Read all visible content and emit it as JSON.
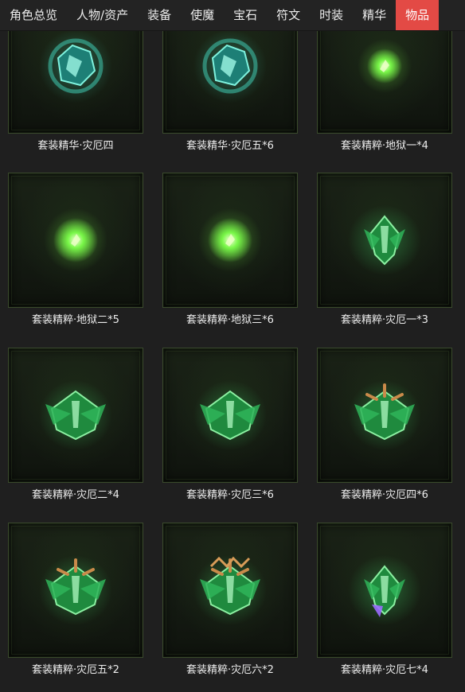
{
  "tabs": [
    {
      "label": "角色总览",
      "active": false
    },
    {
      "label": "人物/资产",
      "active": false
    },
    {
      "label": "装备",
      "active": false
    },
    {
      "label": "使魔",
      "active": false
    },
    {
      "label": "宝石",
      "active": false
    },
    {
      "label": "符文",
      "active": false
    },
    {
      "label": "时装",
      "active": false
    },
    {
      "label": "精华",
      "active": false
    },
    {
      "label": "物品",
      "active": true
    }
  ],
  "colors": {
    "active_tab": "#e34a45",
    "background": "#1f1f1f",
    "frame_border": "#3a4a2c"
  },
  "items": [
    {
      "name": "套装精华·灾厄四",
      "icon": "teal-essence-crest-icon",
      "color": "#3fc9b0"
    },
    {
      "name": "套装精华·灾厄五*6",
      "icon": "teal-essence-crest-icon",
      "color": "#3fc9b0"
    },
    {
      "name": "套装精粹·地狱一*4",
      "icon": "green-glow-orb-small-icon",
      "color": "#7cff4a"
    },
    {
      "name": "套装精粹·地狱二*5",
      "icon": "green-glow-orb-icon",
      "color": "#7cff4a"
    },
    {
      "name": "套装精粹·地狱三*6",
      "icon": "green-glow-orb-icon",
      "color": "#7cff4a"
    },
    {
      "name": "套装精粹·灾厄一*3",
      "icon": "green-crystal-shard-icon",
      "color": "#3ed36a"
    },
    {
      "name": "套装精粹·灾厄二*4",
      "icon": "green-leaf-crest-icon",
      "color": "#3ed36a"
    },
    {
      "name": "套装精粹·灾厄三*6",
      "icon": "green-leaf-crest-icon",
      "color": "#3ed36a"
    },
    {
      "name": "套装精粹·灾厄四*6",
      "icon": "green-horned-crest-icon",
      "color": "#3ed36a"
    },
    {
      "name": "套装精粹·灾厄五*2",
      "icon": "green-gold-crest-icon",
      "color": "#3ed36a"
    },
    {
      "name": "套装精粹·灾厄六*2",
      "icon": "green-gold-crown-crest-icon",
      "color": "#3ed36a"
    },
    {
      "name": "套装精粹·灾厄七*4",
      "icon": "green-violet-blade-crest-icon",
      "color": "#3ed36a"
    }
  ]
}
